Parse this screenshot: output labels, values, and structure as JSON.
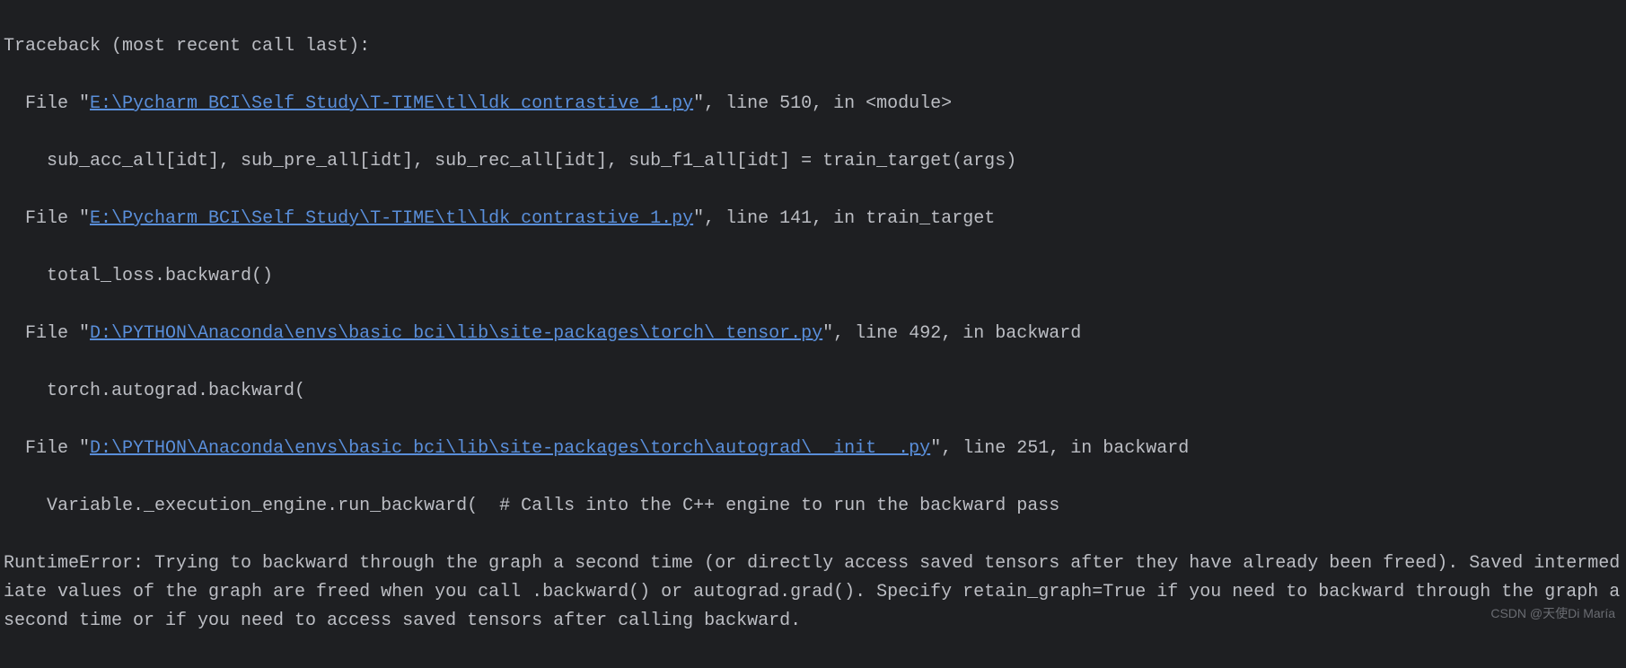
{
  "traceback": {
    "header": "Traceback (most recent call last):",
    "frames": [
      {
        "prefix": "  File \"",
        "path": "E:\\Pycharm_BCI\\Self_Study\\T-TIME\\tl\\ldk_contrastive_1.py",
        "suffix": "\", line 510, in <module>",
        "code": "    sub_acc_all[idt], sub_pre_all[idt], sub_rec_all[idt], sub_f1_all[idt] = train_target(args)"
      },
      {
        "prefix": "  File \"",
        "path": "E:\\Pycharm_BCI\\Self_Study\\T-TIME\\tl\\ldk_contrastive_1.py",
        "suffix": "\", line 141, in train_target",
        "code": "    total_loss.backward()"
      },
      {
        "prefix": "  File \"",
        "path": "D:\\PYTHON\\Anaconda\\envs\\basic_bci\\lib\\site-packages\\torch\\_tensor.py",
        "suffix": "\", line 492, in backward",
        "code": "    torch.autograd.backward("
      },
      {
        "prefix": "  File \"",
        "path": "D:\\PYTHON\\Anaconda\\envs\\basic_bci\\lib\\site-packages\\torch\\autograd\\__init__.py",
        "suffix": "\", line 251, in backward",
        "code": "    Variable._execution_engine.run_backward(  # Calls into the C++ engine to run the backward pass"
      }
    ],
    "error": "RuntimeError: Trying to backward through the graph a second time (or directly access saved tensors after they have already been freed). Saved intermediate values of the graph are freed when you call .backward() or autograd.grad(). Specify retain_graph=True if you need to backward through the graph a second time or if you need to access saved tensors after calling backward."
  },
  "watermark": "CSDN @天使Di María"
}
